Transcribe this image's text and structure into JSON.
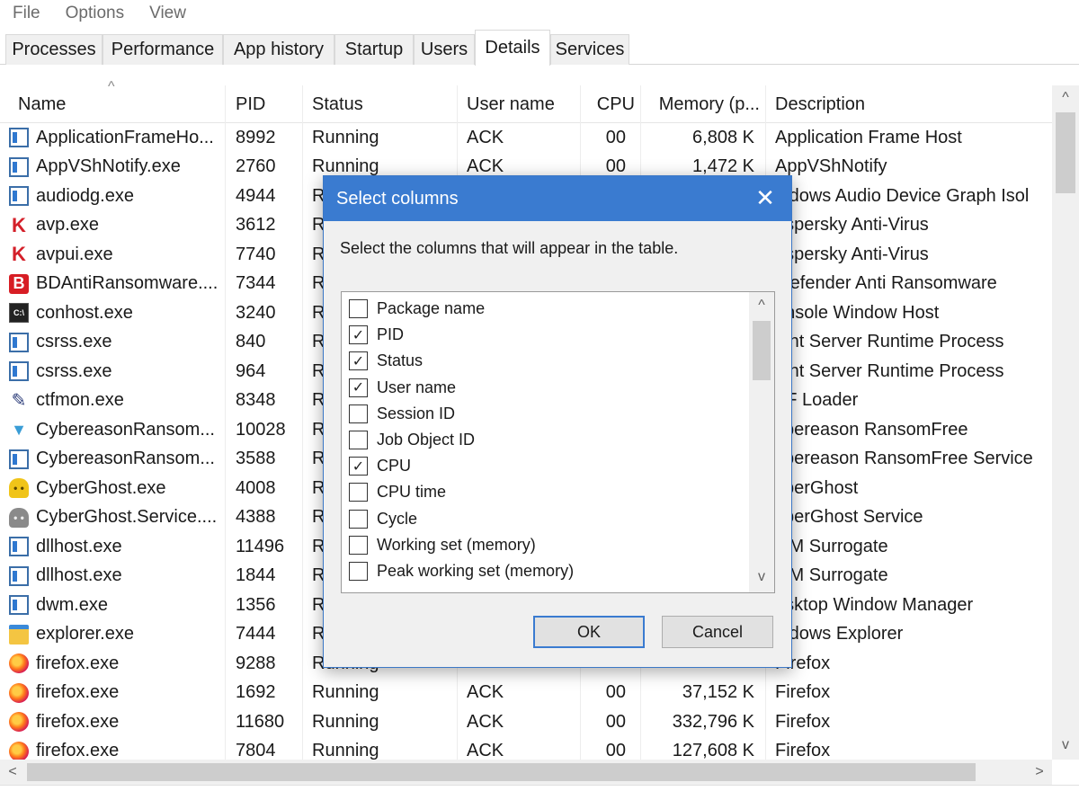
{
  "menu": [
    "File",
    "Options",
    "View"
  ],
  "tabs": [
    "Processes",
    "Performance",
    "App history",
    "Startup",
    "Users",
    "Details",
    "Services"
  ],
  "active_tab": "Details",
  "columns": [
    "Name",
    "PID",
    "Status",
    "User name",
    "CPU",
    "Memory (p...",
    "Description"
  ],
  "sort_indicator": "^",
  "rows": [
    {
      "icon": "window-icon",
      "name": "ApplicationFrameHo...",
      "pid": "8992",
      "status": "Running",
      "user": "ACK",
      "cpu": "00",
      "mem": "6,808 K",
      "desc": "Application Frame Host"
    },
    {
      "icon": "window-icon",
      "name": "AppVShNotify.exe",
      "pid": "2760",
      "status": "Running",
      "user": "ACK",
      "cpu": "00",
      "mem": "1,472 K",
      "desc": "AppVShNotify"
    },
    {
      "icon": "window-icon",
      "name": "audiodg.exe",
      "pid": "4944",
      "status": "R",
      "user": "",
      "cpu": "",
      "mem": "",
      "desc": "indows Audio Device Graph Isol"
    },
    {
      "icon": "kaspersky-icon",
      "name": "avp.exe",
      "pid": "3612",
      "status": "R",
      "user": "",
      "cpu": "",
      "mem": "",
      "desc": "aspersky Anti-Virus"
    },
    {
      "icon": "kaspersky-icon",
      "name": "avpui.exe",
      "pid": "7740",
      "status": "R",
      "user": "",
      "cpu": "",
      "mem": "",
      "desc": "aspersky Anti-Virus"
    },
    {
      "icon": "bitdefender-icon",
      "name": "BDAntiRansomware....",
      "pid": "7344",
      "status": "R",
      "user": "",
      "cpu": "",
      "mem": "",
      "desc": "tdefender Anti Ransomware"
    },
    {
      "icon": "console-icon",
      "name": "conhost.exe",
      "pid": "3240",
      "status": "R",
      "user": "",
      "cpu": "",
      "mem": "",
      "desc": "onsole Window Host"
    },
    {
      "icon": "window-icon",
      "name": "csrss.exe",
      "pid": "840",
      "status": "R",
      "user": "",
      "cpu": "",
      "mem": "",
      "desc": "ient Server Runtime Process"
    },
    {
      "icon": "window-icon",
      "name": "csrss.exe",
      "pid": "964",
      "status": "R",
      "user": "",
      "cpu": "",
      "mem": "",
      "desc": "ient Server Runtime Process"
    },
    {
      "icon": "pen-icon",
      "name": "ctfmon.exe",
      "pid": "8348",
      "status": "R",
      "user": "",
      "cpu": "",
      "mem": "",
      "desc": "TF Loader"
    },
    {
      "icon": "cybereason-icon",
      "name": "CybereasonRansom...",
      "pid": "10028",
      "status": "R",
      "user": "",
      "cpu": "",
      "mem": "",
      "desc": "ybereason RansomFree"
    },
    {
      "icon": "window-icon",
      "name": "CybereasonRansom...",
      "pid": "3588",
      "status": "R",
      "user": "",
      "cpu": "",
      "mem": "",
      "desc": "ybereason RansomFree Service"
    },
    {
      "icon": "ghost-yellow-icon",
      "name": "CyberGhost.exe",
      "pid": "4008",
      "status": "R",
      "user": "",
      "cpu": "",
      "mem": "",
      "desc": "yberGhost"
    },
    {
      "icon": "ghost-gray-icon",
      "name": "CyberGhost.Service....",
      "pid": "4388",
      "status": "R",
      "user": "",
      "cpu": "",
      "mem": "",
      "desc": "yberGhost Service"
    },
    {
      "icon": "window-icon",
      "name": "dllhost.exe",
      "pid": "11496",
      "status": "R",
      "user": "",
      "cpu": "",
      "mem": "",
      "desc": "OM Surrogate"
    },
    {
      "icon": "window-icon",
      "name": "dllhost.exe",
      "pid": "1844",
      "status": "R",
      "user": "",
      "cpu": "",
      "mem": "",
      "desc": "OM Surrogate"
    },
    {
      "icon": "window-icon",
      "name": "dwm.exe",
      "pid": "1356",
      "status": "R",
      "user": "",
      "cpu": "",
      "mem": "",
      "desc": "esktop Window Manager"
    },
    {
      "icon": "folder-icon",
      "name": "explorer.exe",
      "pid": "7444",
      "status": "R",
      "user": "",
      "cpu": "",
      "mem": "",
      "desc": "indows Explorer"
    },
    {
      "icon": "firefox-icon",
      "name": "firefox.exe",
      "pid": "9288",
      "status": "Running",
      "user": "",
      "cpu": "",
      "mem": "",
      "desc": "Firefox"
    },
    {
      "icon": "firefox-icon",
      "name": "firefox.exe",
      "pid": "1692",
      "status": "Running",
      "user": "ACK",
      "cpu": "00",
      "mem": "37,152 K",
      "desc": "Firefox"
    },
    {
      "icon": "firefox-icon",
      "name": "firefox.exe",
      "pid": "11680",
      "status": "Running",
      "user": "ACK",
      "cpu": "00",
      "mem": "332,796 K",
      "desc": "Firefox"
    },
    {
      "icon": "firefox-icon",
      "name": "firefox.exe",
      "pid": "7804",
      "status": "Running",
      "user": "ACK",
      "cpu": "00",
      "mem": "127,608 K",
      "desc": "Firefox"
    }
  ],
  "dialog": {
    "title": "Select columns",
    "close_glyph": "✕",
    "prompt": "Select the columns that will appear in the table.",
    "options": [
      {
        "label": "Package name",
        "checked": false
      },
      {
        "label": "PID",
        "checked": true
      },
      {
        "label": "Status",
        "checked": true
      },
      {
        "label": "User name",
        "checked": true
      },
      {
        "label": "Session ID",
        "checked": false
      },
      {
        "label": "Job Object ID",
        "checked": false
      },
      {
        "label": "CPU",
        "checked": true
      },
      {
        "label": "CPU time",
        "checked": false
      },
      {
        "label": "Cycle",
        "checked": false
      },
      {
        "label": "Working set (memory)",
        "checked": false
      },
      {
        "label": "Peak working set (memory)",
        "checked": false
      }
    ],
    "ok_label": "OK",
    "cancel_label": "Cancel"
  },
  "colors": {
    "dialog_title_bg": "#3a7bd0",
    "dialog_border": "#3c78c6"
  }
}
